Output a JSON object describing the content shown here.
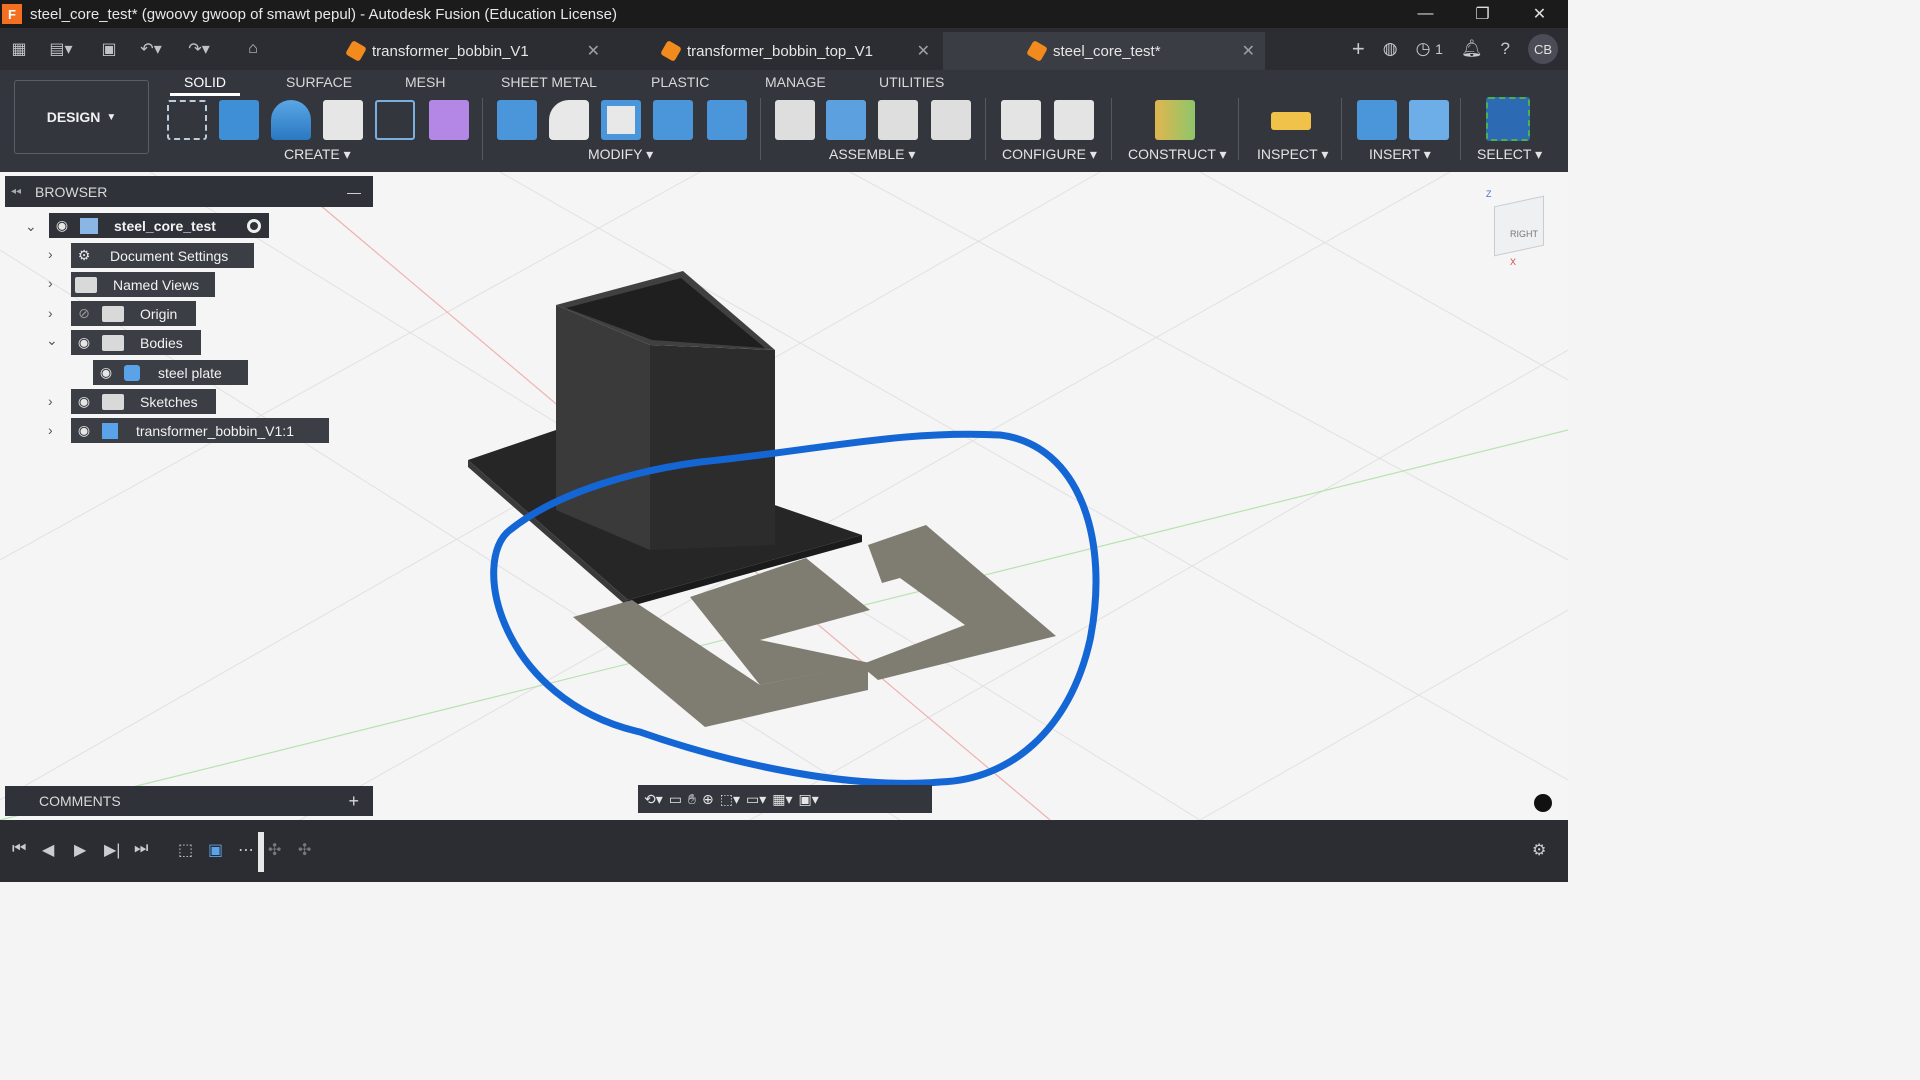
{
  "window": {
    "app_icon_letter": "F",
    "title": "steel_core_test* (gwoovy gwoop of smawt pepul) - Autodesk Fusion (Education License)",
    "controls": [
      "—",
      "❐",
      "✕"
    ]
  },
  "tabs": [
    {
      "label": "transformer_bobbin_V1",
      "active": false
    },
    {
      "label": "transformer_bobbin_top_V1",
      "active": false
    },
    {
      "label": "steel_core_test*",
      "active": true
    }
  ],
  "header_right": {
    "job_count": "1",
    "avatar": "CB"
  },
  "workspace": {
    "label": "DESIGN"
  },
  "ribbon_tabs": [
    "SOLID",
    "SURFACE",
    "MESH",
    "SHEET METAL",
    "PLASTIC",
    "MANAGE",
    "UTILITIES"
  ],
  "tool_groups": [
    "CREATE",
    "MODIFY",
    "ASSEMBLE",
    "CONFIGURE",
    "CONSTRUCT",
    "INSPECT",
    "INSERT",
    "SELECT"
  ],
  "browser": {
    "title": "BROWSER",
    "root": "steel_core_test",
    "items": [
      {
        "label": "Document Settings"
      },
      {
        "label": "Named Views"
      },
      {
        "label": "Origin"
      },
      {
        "label": "Bodies"
      },
      {
        "label": "steel plate"
      },
      {
        "label": "Sketches"
      },
      {
        "label": "transformer_bobbin_V1:1"
      }
    ]
  },
  "viewcube": {
    "face_label": "RIGHT",
    "axis_z": "Z",
    "axis_x": "X"
  },
  "comments": {
    "title": "COMMENTS",
    "add": "+"
  },
  "colors": {
    "annotation_stroke": "#1466d4",
    "plate_fill": "#7f7c72",
    "bobbin_fill": "#2f2f2f",
    "accent": "#f36f21"
  }
}
